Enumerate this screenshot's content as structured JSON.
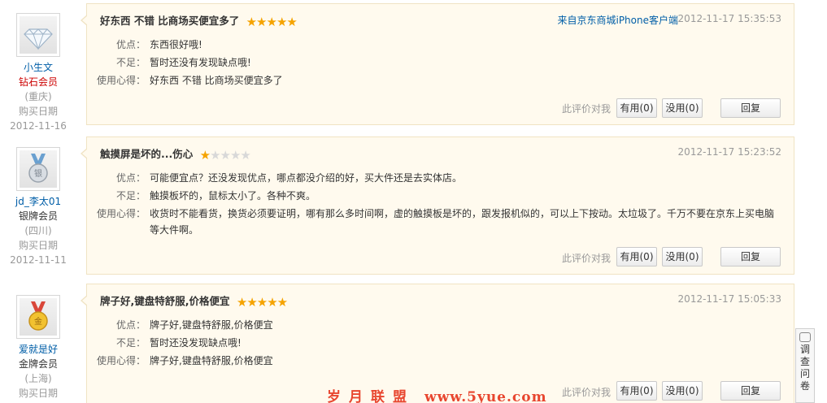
{
  "reviews": [
    {
      "user": {
        "name": "小生文",
        "level": "钻石会员",
        "region": "(重庆)",
        "purchase_label": "购买日期",
        "purchase_date": "2012-11-16",
        "avatar_icon": "diamond-icon"
      },
      "title": "好东西 不错 比商场买便宜多了",
      "rating": 5,
      "source": "来自京东商城iPhone客户端",
      "time": "2012-11-17 15:35:53",
      "pros_label": "优点：",
      "pros": "东西很好哦!",
      "cons_label": "不足：",
      "cons": "暂时还没有发现缺点哦!",
      "exp_label": "使用心得：",
      "exp": "好东西 不错 比商场买便宜多了",
      "helpful_prompt": "此评价对我",
      "yes_label": "有用(0)",
      "no_label": "没用(0)",
      "reply_label": "回复"
    },
    {
      "user": {
        "name": "jd_李太01",
        "level": "银牌会员",
        "region": "(四川)",
        "purchase_label": "购买日期",
        "purchase_date": "2012-11-11",
        "avatar_icon": "silver-medal-icon"
      },
      "title": "触摸屏是坏的...伤心",
      "rating": 1,
      "source": "",
      "time": "2012-11-17 15:23:52",
      "pros_label": "优点：",
      "pros": "可能便宜点？还没发现优点，哪点都没介绍的好，买大件还是去实体店。",
      "cons_label": "不足：",
      "cons": "触摸板坏的，鼠标太小了。各种不爽。",
      "exp_label": "使用心得：",
      "exp": "收货时不能看货，换货必须要证明，哪有那么多时间啊，虚的触摸板是坏的，跟发报机似的，可以上下按动。太垃圾了。千万不要在京东上买电脑等大件啊。",
      "helpful_prompt": "此评价对我",
      "yes_label": "有用(0)",
      "no_label": "没用(0)",
      "reply_label": "回复"
    },
    {
      "user": {
        "name": "爱就是好",
        "level": "金牌会员",
        "region": "(上海)",
        "purchase_label": "购买日期",
        "purchase_date": "",
        "avatar_icon": "gold-medal-icon"
      },
      "title": "牌子好,键盘特舒服,价格便宜",
      "rating": 5,
      "source": "",
      "time": "2012-11-17 15:05:33",
      "pros_label": "优点：",
      "pros": "牌子好,键盘特舒服,价格便宜",
      "cons_label": "不足：",
      "cons": "暂时还没发现缺点哦!",
      "exp_label": "使用心得：",
      "exp": "牌子好,键盘特舒服,价格便宜",
      "helpful_prompt": "此评价对我",
      "yes_label": "有用(0)",
      "no_label": "没用(0)",
      "reply_label": "回复"
    }
  ],
  "survey_label": "调查问卷",
  "watermark": {
    "text": "岁月联盟",
    "url": "www.5yue.com"
  },
  "colors": {
    "accent_link": "#005ea7",
    "star": "#f5a300",
    "card_bg": "#fffaee",
    "diamond_level": "#cc0000"
  }
}
